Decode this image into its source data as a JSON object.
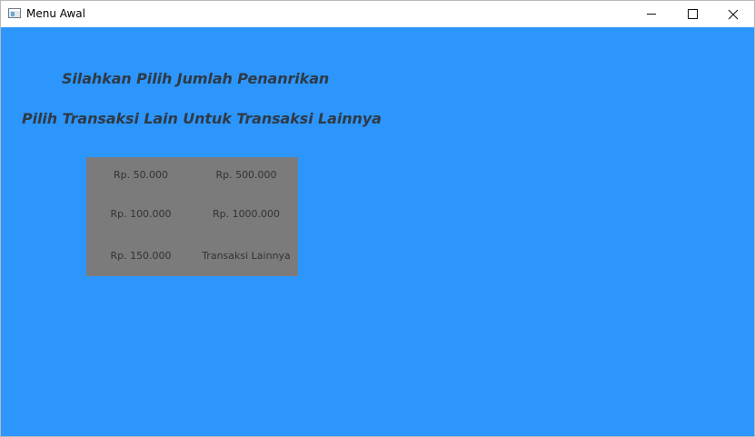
{
  "window": {
    "title": "Menu Awal",
    "controls": {
      "minimize": "minimize-icon",
      "maximize": "maximize-icon",
      "close": "close-icon"
    }
  },
  "colors": {
    "background": "#2d96fd",
    "panel": "#7b7b7b",
    "heading_text": "#2e3a46",
    "button_text": "#333333"
  },
  "headings": {
    "choose_amount": "Silahkan Pilih Jumlah Penanrikan",
    "other_transaction_hint": "Pilih Transaksi Lain Untuk Transaksi Lainnya"
  },
  "options": [
    {
      "label": "Rp. 50.000"
    },
    {
      "label": "Rp. 500.000"
    },
    {
      "label": "Rp. 100.000"
    },
    {
      "label": "Rp. 1000.000"
    },
    {
      "label": "Rp. 150.000"
    },
    {
      "label": "Transaksi Lainnya"
    }
  ]
}
